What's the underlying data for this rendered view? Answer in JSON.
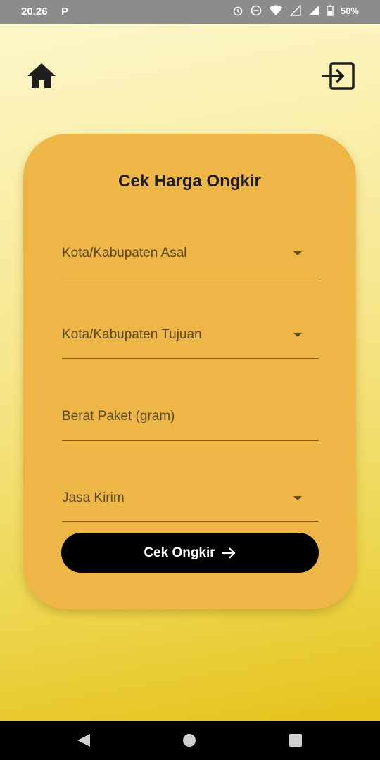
{
  "status_bar": {
    "time": "20.26",
    "notification_icon": "P",
    "battery_text": "50%",
    "icons": [
      "alarm-icon",
      "do-not-disturb-icon",
      "wifi-icon",
      "signal-icon",
      "signal-icon",
      "battery-icon"
    ]
  },
  "header": {
    "left_icon": "home-icon",
    "right_icon": "login-icon"
  },
  "card": {
    "title": "Cek Harga Ongkir",
    "fields": [
      {
        "label": "Kota/Kabupaten Asal",
        "type": "dropdown"
      },
      {
        "label": "Kota/Kabupaten Tujuan",
        "type": "dropdown"
      },
      {
        "label": "Berat Paket (gram)",
        "type": "text"
      },
      {
        "label": "Jasa Kirim",
        "type": "dropdown"
      }
    ],
    "submit_label": "Cek Ongkir"
  },
  "colors": {
    "card": "#eeb646",
    "button": "#000000",
    "background_top": "#fdf7c9",
    "background_bottom": "#e5c21a"
  }
}
